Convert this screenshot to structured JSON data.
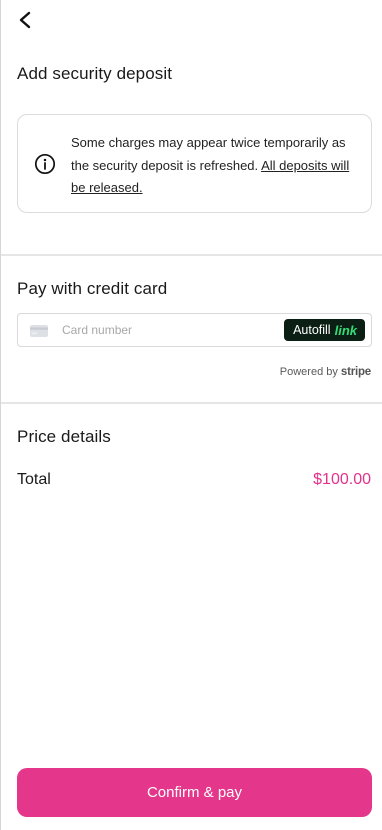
{
  "header": {
    "back_icon": "chevron-left-icon"
  },
  "deposit": {
    "title": "Add security deposit",
    "notice_icon": "info-icon",
    "notice_text": "Some charges may appear twice temporarily as the security deposit is refreshed.",
    "notice_link": "All deposits will be released."
  },
  "payment": {
    "title": "Pay with credit card",
    "card_icon": "credit-card-icon",
    "card_placeholder": "Card number",
    "autofill_label": "Autofill",
    "autofill_brand": "link",
    "powered_by": "Powered by",
    "powered_brand": "stripe"
  },
  "price": {
    "title": "Price details",
    "total_label": "Total",
    "total_value": "$100.00"
  },
  "footer": {
    "confirm_label": "Confirm & pay"
  },
  "colors": {
    "accent": "#e4368b",
    "price": "#e2338c",
    "link_green": "#33dd77"
  }
}
